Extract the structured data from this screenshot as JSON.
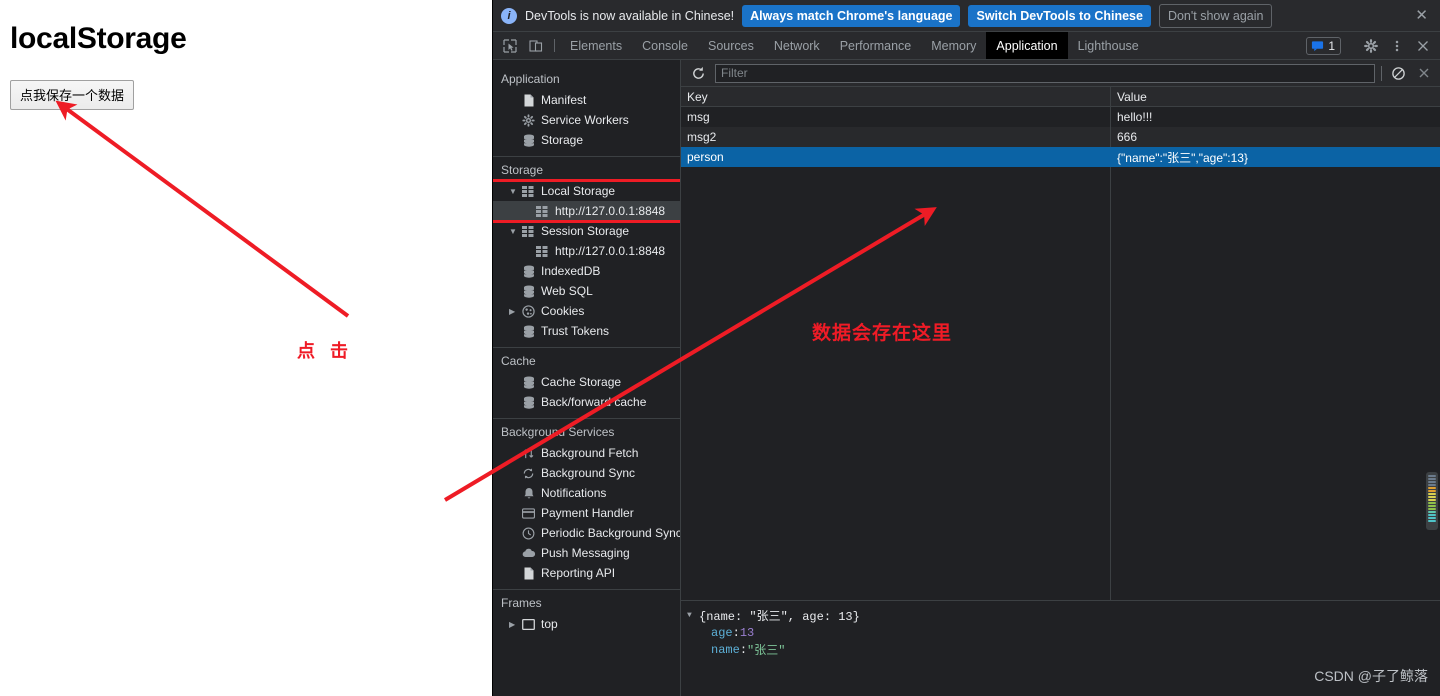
{
  "page": {
    "title": "localStorage",
    "save_button_label": "点我保存一个数据"
  },
  "annotations": {
    "click_label": "点 击",
    "stored_label": "数据会存在这里",
    "arrow_color": "#ee1c25",
    "highlight_color": "#ee1c25"
  },
  "devtools": {
    "banner": {
      "info_icon": "info-icon",
      "message": "DevTools is now available in Chinese!",
      "primary_button": "Always match Chrome's language",
      "secondary_button": "Switch DevTools to Chinese",
      "dismiss_button": "Don't show again",
      "close_icon": "close-icon",
      "accent_color": "#1a73c8"
    },
    "tabbar": {
      "inspect_icon": "inspect-element-icon",
      "device_icon": "device-toolbar-icon",
      "tabs": [
        {
          "label": "Elements",
          "active": false
        },
        {
          "label": "Console",
          "active": false
        },
        {
          "label": "Sources",
          "active": false
        },
        {
          "label": "Network",
          "active": false
        },
        {
          "label": "Performance",
          "active": false
        },
        {
          "label": "Memory",
          "active": false
        },
        {
          "label": "Application",
          "active": true
        },
        {
          "label": "Lighthouse",
          "active": false
        }
      ],
      "message_count": "1",
      "message_icon": "message-icon",
      "settings_icon": "gear-icon",
      "more_icon": "kebab-menu-icon",
      "close_icon": "close-icon"
    },
    "sidebar": {
      "sections": [
        {
          "title": "Application",
          "items": [
            {
              "label": "Manifest",
              "icon": "manifest-file-icon",
              "indent": 1,
              "twisty": "",
              "selected": false
            },
            {
              "label": "Service Workers",
              "icon": "gear-icon",
              "indent": 1,
              "twisty": "",
              "selected": false
            },
            {
              "label": "Storage",
              "icon": "database-icon",
              "indent": 1,
              "twisty": "",
              "selected": false
            }
          ]
        },
        {
          "title": "Storage",
          "items": [
            {
              "label": "Local Storage",
              "icon": "table-icon",
              "indent": 1,
              "twisty": "▼",
              "selected": false
            },
            {
              "label": "http://127.0.0.1:8848",
              "icon": "table-icon",
              "indent": 2,
              "twisty": "",
              "selected": true
            },
            {
              "label": "Session Storage",
              "icon": "table-icon",
              "indent": 1,
              "twisty": "▼",
              "selected": false
            },
            {
              "label": "http://127.0.0.1:8848",
              "icon": "table-icon",
              "indent": 2,
              "twisty": "",
              "selected": false
            },
            {
              "label": "IndexedDB",
              "icon": "database-icon",
              "indent": 1,
              "twisty": "",
              "selected": false
            },
            {
              "label": "Web SQL",
              "icon": "database-icon",
              "indent": 1,
              "twisty": "",
              "selected": false
            },
            {
              "label": "Cookies",
              "icon": "cookie-icon",
              "indent": 1,
              "twisty": "▶",
              "selected": false
            },
            {
              "label": "Trust Tokens",
              "icon": "database-icon",
              "indent": 1,
              "twisty": "",
              "selected": false
            }
          ]
        },
        {
          "title": "Cache",
          "items": [
            {
              "label": "Cache Storage",
              "icon": "database-icon",
              "indent": 1,
              "twisty": "",
              "selected": false
            },
            {
              "label": "Back/forward cache",
              "icon": "database-icon",
              "indent": 1,
              "twisty": "",
              "selected": false
            }
          ]
        },
        {
          "title": "Background Services",
          "items": [
            {
              "label": "Background Fetch",
              "icon": "arrows-up-down-icon",
              "indent": 1,
              "twisty": "",
              "selected": false
            },
            {
              "label": "Background Sync",
              "icon": "sync-icon",
              "indent": 1,
              "twisty": "",
              "selected": false
            },
            {
              "label": "Notifications",
              "icon": "bell-icon",
              "indent": 1,
              "twisty": "",
              "selected": false
            },
            {
              "label": "Payment Handler",
              "icon": "credit-card-icon",
              "indent": 1,
              "twisty": "",
              "selected": false
            },
            {
              "label": "Periodic Background Sync",
              "icon": "clock-icon",
              "indent": 1,
              "twisty": "",
              "selected": false
            },
            {
              "label": "Push Messaging",
              "icon": "cloud-icon",
              "indent": 1,
              "twisty": "",
              "selected": false
            },
            {
              "label": "Reporting API",
              "icon": "document-icon",
              "indent": 1,
              "twisty": "",
              "selected": false
            }
          ]
        },
        {
          "title": "Frames",
          "items": [
            {
              "label": "top",
              "icon": "frame-icon",
              "indent": 1,
              "twisty": "▶",
              "selected": false
            }
          ]
        }
      ]
    },
    "filterbar": {
      "refresh_icon": "refresh-icon",
      "filter_placeholder": "Filter",
      "filter_value": "",
      "clear_icon": "clear-all-icon",
      "delete_icon": "delete-selected-icon"
    },
    "table": {
      "columns": [
        "Key",
        "Value"
      ],
      "rows": [
        {
          "key": "msg",
          "value": "hello!!!",
          "selected": false
        },
        {
          "key": "msg2",
          "value": "666",
          "selected": false
        },
        {
          "key": "person",
          "value": "{\"name\":\"张三\",\"age\":13}",
          "selected": true
        }
      ]
    },
    "preview": {
      "root": "{name: \"张三\", age: 13}",
      "root_twisty": "▼",
      "lines": [
        {
          "key": "age",
          "sep": ": ",
          "value": "13",
          "kind": "number"
        },
        {
          "key": "name",
          "sep": ": ",
          "value": "\"张三\"",
          "kind": "string"
        }
      ]
    }
  },
  "watermark": "CSDN @子了鲸落"
}
